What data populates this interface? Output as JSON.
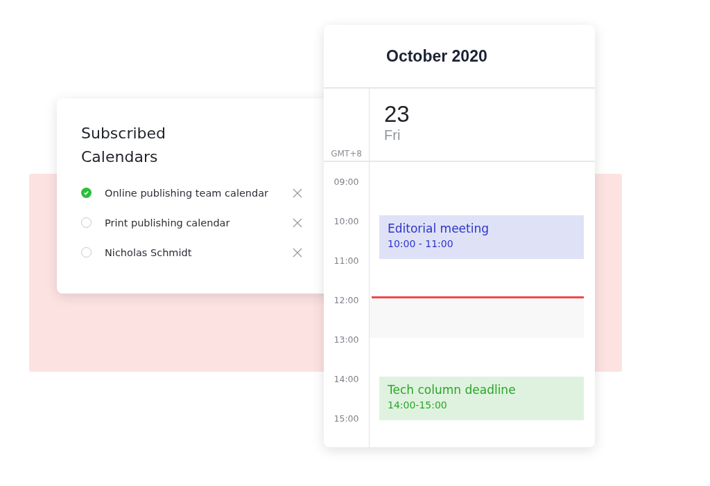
{
  "subscribed_calendars": {
    "title": "Subscribed Calendars",
    "items": [
      {
        "name": "Online publishing team calendar",
        "checked": true
      },
      {
        "name": "Print publishing calendar",
        "checked": false
      },
      {
        "name": "Nicholas Schmidt",
        "checked": false
      }
    ]
  },
  "calendar": {
    "month": "October 2020",
    "timezone": "GMT+8",
    "day_number": "23",
    "weekday": "Fri",
    "hours": [
      "09:00",
      "10:00",
      "11:00",
      "12:00",
      "13:00",
      "14:00",
      "15:00"
    ],
    "events": [
      {
        "title": "Editorial meeting",
        "time": "10:00 - 11:00",
        "color": "#2a34c8"
      },
      {
        "title": "Tech column deadline",
        "time": "14:00-15:00",
        "color": "#2aa52a"
      }
    ]
  }
}
